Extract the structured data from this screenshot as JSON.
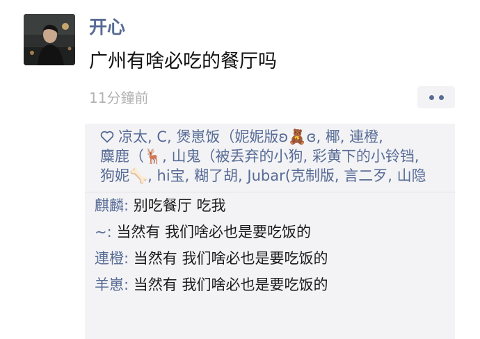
{
  "post": {
    "username": "开心",
    "text": "广州有啥必吃的餐厅吗",
    "timestamp": "11分鐘前"
  },
  "likes": {
    "icon": "heart-outline-icon",
    "names": [
      "凉太",
      "C",
      "煲崽饭（妮妮版ʚ🧸ɞ",
      "椰",
      "連橙",
      "麋鹿（🦌",
      "山鬼（被丢弃的小狗",
      "彩黄下的小铃铛",
      "狗妮🦴",
      "hi宝",
      "糊了胡",
      "Jubar(克制版",
      "言二歹",
      "山隐"
    ]
  },
  "comments": [
    {
      "author": "麒麟",
      "text": "别吃餐厅 吃我"
    },
    {
      "author": "~",
      "text": "当然有 我们啥必也是要吃饭的"
    },
    {
      "author": "連橙",
      "text": "当然有 我们啥必也是要吃饭的"
    },
    {
      "author": "羊崽",
      "text": "当然有 我们啥必也是要吃饭的"
    }
  ],
  "colors": {
    "name_blue": "#576b95",
    "panel_bg": "#f3f3f5",
    "timestamp_gray": "#b2b2b2",
    "text": "#111111"
  }
}
